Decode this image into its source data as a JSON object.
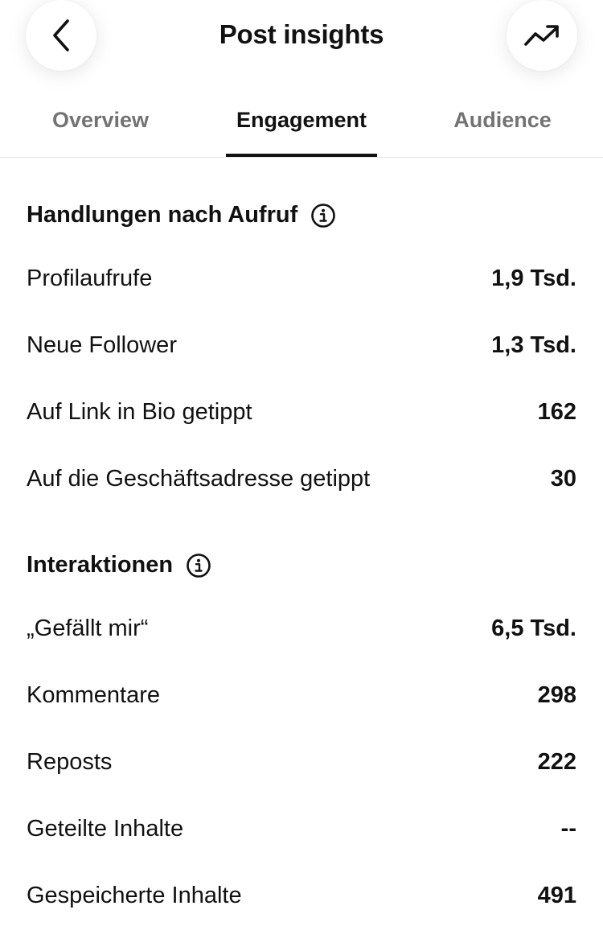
{
  "header": {
    "title": "Post insights",
    "back_icon": "chevron-left-icon",
    "trend_icon": "trending-up-icon"
  },
  "tabs": [
    {
      "label": "Overview",
      "active": false
    },
    {
      "label": "Engagement",
      "active": true
    },
    {
      "label": "Audience",
      "active": false
    }
  ],
  "sections": [
    {
      "title": "Handlungen nach Aufruf",
      "icon": "info-icon",
      "rows": [
        {
          "label": "Profilaufrufe",
          "value": "1,9 Tsd."
        },
        {
          "label": "Neue Follower",
          "value": "1,3 Tsd."
        },
        {
          "label": "Auf Link in Bio getippt",
          "value": "162"
        },
        {
          "label": "Auf die Geschäftsadresse getippt",
          "value": "30"
        }
      ]
    },
    {
      "title": "Interaktionen",
      "icon": "info-icon",
      "rows": [
        {
          "label": "„Gefällt mir“",
          "value": "6,5 Tsd."
        },
        {
          "label": "Kommentare",
          "value": "298"
        },
        {
          "label": "Reposts",
          "value": "222"
        },
        {
          "label": "Geteilte Inhalte",
          "value": "--"
        },
        {
          "label": "Gespeicherte Inhalte",
          "value": "491"
        }
      ]
    }
  ]
}
